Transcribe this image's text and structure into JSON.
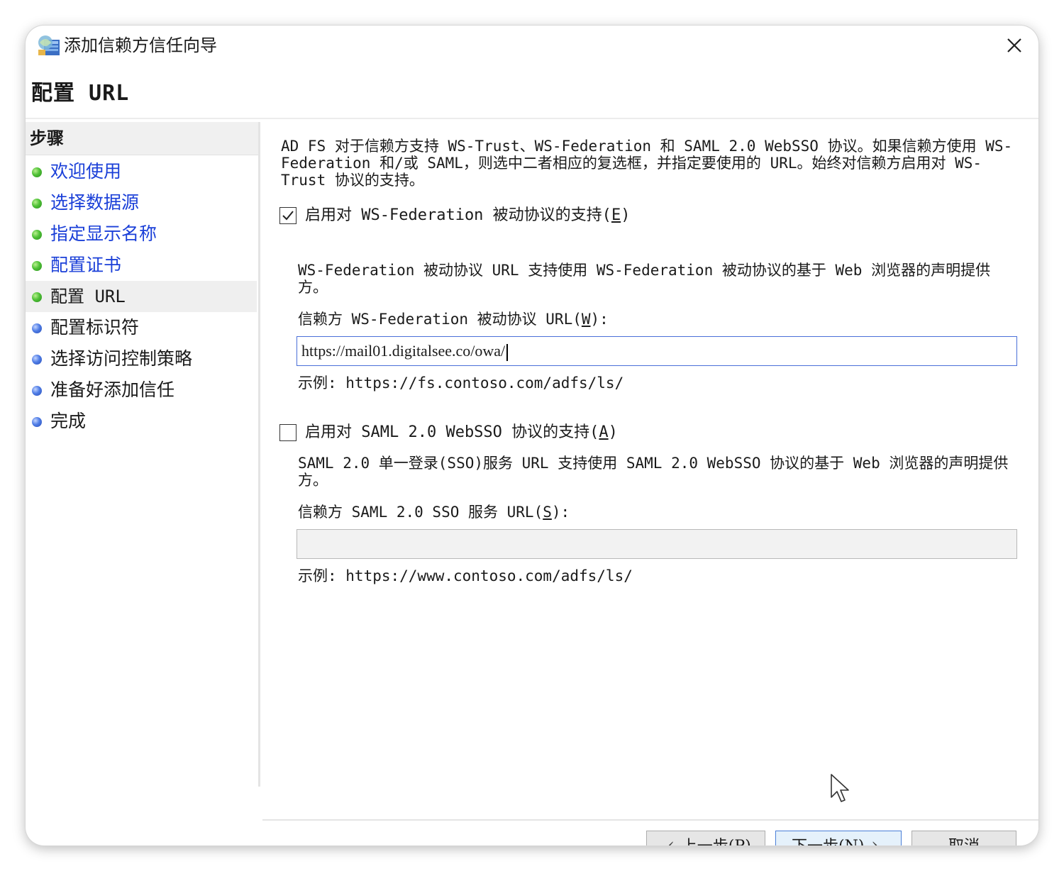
{
  "window": {
    "title": "添加信赖方信任向导"
  },
  "page": {
    "title": "配置 URL"
  },
  "sidebar": {
    "header": "步骤",
    "steps": [
      {
        "label": "欢迎使用",
        "state": "done"
      },
      {
        "label": "选择数据源",
        "state": "done"
      },
      {
        "label": "指定显示名称",
        "state": "done"
      },
      {
        "label": "配置证书",
        "state": "done"
      },
      {
        "label": "配置 URL",
        "state": "current"
      },
      {
        "label": "配置标识符",
        "state": "todo"
      },
      {
        "label": "选择访问控制策略",
        "state": "todo"
      },
      {
        "label": "准备好添加信任",
        "state": "todo"
      },
      {
        "label": "完成",
        "state": "todo"
      }
    ]
  },
  "content": {
    "intro": "AD FS 对于信赖方支持 WS-Trust、WS-Federation 和 SAML 2.0 WebSSO 协议。如果信赖方使用 WS-Federation 和/或 SAML，则选中二者相应的复选框，并指定要使用的 URL。始终对信赖方启用对 WS-Trust 协议的支持。",
    "wsfed": {
      "checked": true,
      "checkbox_label_pre": "启用对 WS-Federation 被动协议的支持(",
      "checkbox_label_key": "E",
      "checkbox_label_post": ")",
      "description": "WS-Federation 被动协议 URL 支持使用 WS-Federation 被动协议的基于 Web 浏览器的声明提供方。",
      "field_label_pre": "信赖方 WS-Federation 被动协议 URL(",
      "field_label_key": "W",
      "field_label_post": "):",
      "url_value": "https://mail01.digitalsee.co/owa/",
      "example": "示例: https://fs.contoso.com/adfs/ls/"
    },
    "saml": {
      "checked": false,
      "checkbox_label_pre": "启用对 SAML 2.0 WebSSO 协议的支持(",
      "checkbox_label_key": "A",
      "checkbox_label_post": ")",
      "description": "SAML 2.0 单一登录(SSO)服务 URL 支持使用 SAML 2.0 WebSSO 协议的基于 Web 浏览器的声明提供方。",
      "field_label_pre": "信赖方 SAML 2.0 SSO 服务 URL(",
      "field_label_key": "S",
      "field_label_post": "):",
      "url_value": "",
      "example": "示例: https://www.contoso.com/adfs/ls/"
    }
  },
  "buttons": {
    "prev_pre": "上一步(",
    "prev_key": "P",
    "prev_post": ")",
    "next_pre": "下一步(",
    "next_key": "N",
    "next_post": ")",
    "cancel": "取消"
  },
  "colors": {
    "link": "#1a3fd8",
    "step_done": "#4fc136",
    "step_todo": "#4f7de6",
    "focus_border": "#4a6fd8",
    "primary_button_bg": "#e5f1fb"
  }
}
